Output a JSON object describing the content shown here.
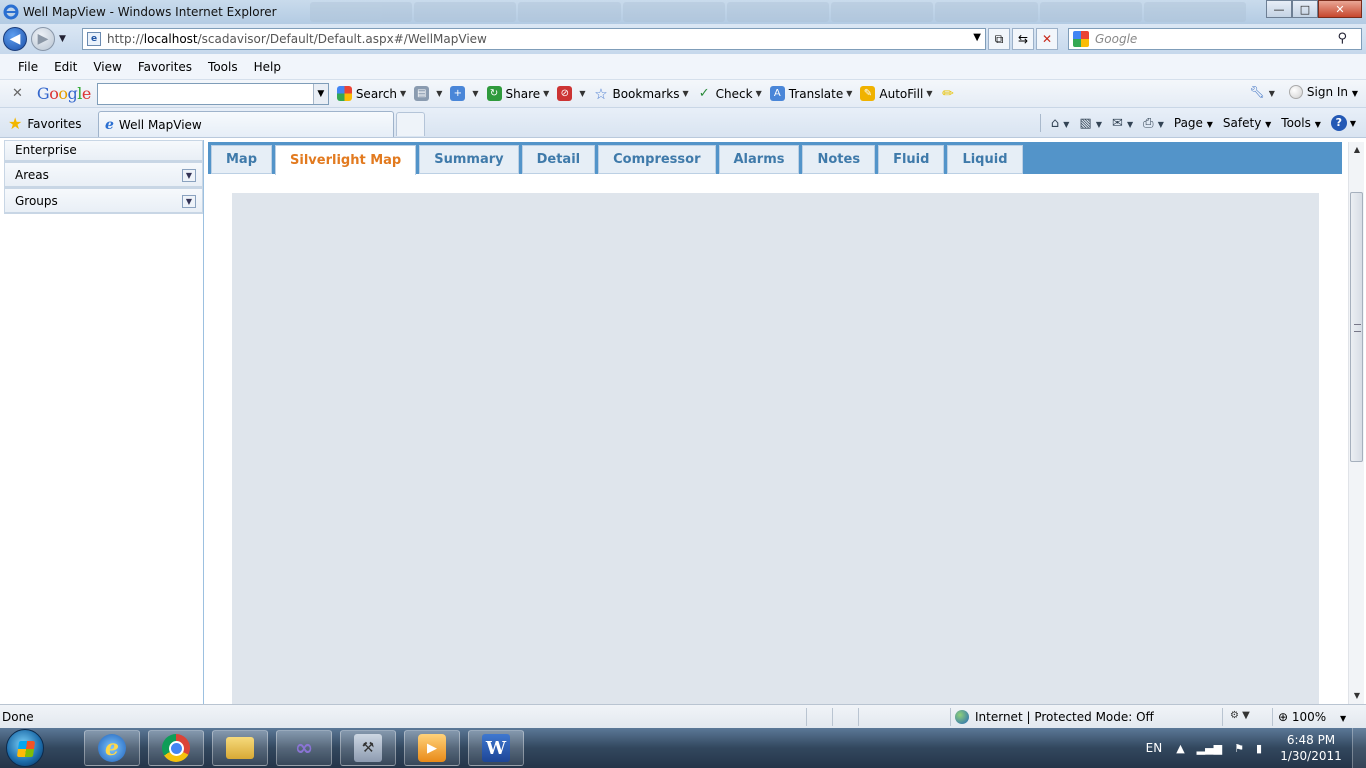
{
  "window": {
    "title": "Well MapView - Windows Internet Explorer",
    "controls": {
      "minimize": "—",
      "maximize": "□",
      "close": "✕"
    }
  },
  "address_bar": {
    "url_prefix": "http://",
    "url_host": "localhost",
    "url_path": "/scadavisor/Default/Default.aspx#/WellMapView",
    "search_placeholder": "Google"
  },
  "menu_bar": {
    "items": [
      "File",
      "Edit",
      "View",
      "Favorites",
      "Tools",
      "Help"
    ]
  },
  "google_toolbar": {
    "close": "✕",
    "logo": [
      "G",
      "o",
      "o",
      "g",
      "l",
      "e"
    ],
    "search_value": "",
    "buttons": {
      "search": "Search",
      "share": "Share",
      "bookmarks": "Bookmarks",
      "check": "Check",
      "translate": "Translate",
      "autofill": "AutoFill",
      "sign_in": "Sign In"
    }
  },
  "tab_bar": {
    "favorites": "Favorites",
    "active_tab": "Well MapView",
    "commands": {
      "page": "Page",
      "safety": "Safety",
      "tools": "Tools"
    }
  },
  "left_panel": {
    "items": [
      {
        "label": "Enterprise",
        "has_dropdown": false
      },
      {
        "label": "Areas",
        "has_dropdown": true
      },
      {
        "label": "Groups",
        "has_dropdown": true
      }
    ]
  },
  "main_tabs": {
    "active": "Silverlight Map",
    "items": [
      "Map",
      "Silverlight Map",
      "Summary",
      "Detail",
      "Compressor",
      "Alarms",
      "Notes",
      "Fluid",
      "Liquid"
    ]
  },
  "status_bar": {
    "status": "Done",
    "zone": "Internet | Protected Mode: Off",
    "zoom": "100%"
  },
  "taskbar": {
    "language": "EN",
    "time": "6:48 PM",
    "date": "1/30/2011"
  },
  "colors": {
    "tab_strip": "#5394c9",
    "active_tab_text": "#e27a1f",
    "tab_text": "#3f7aaa",
    "map_area": "#dfe5ec"
  },
  "icons": [
    "ie-icon",
    "back-icon",
    "forward-icon",
    "page-icon",
    "compat-view-icon",
    "refresh-icon",
    "stop-icon",
    "google-icon",
    "search-icon",
    "star-icon",
    "home-icon",
    "feeds-icon",
    "mail-icon",
    "print-icon",
    "help-icon",
    "start-orb-icon",
    "chrome-icon",
    "folder-icon",
    "visual-studio-icon",
    "word-icon"
  ]
}
